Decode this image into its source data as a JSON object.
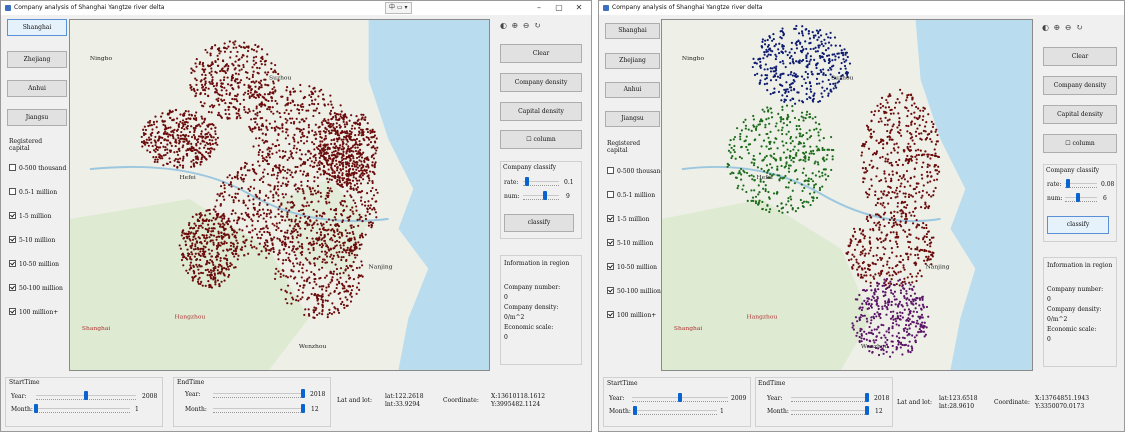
{
  "left": {
    "title": "Company analysis of Shanghai Yangtze river delta",
    "lang_label": "中 ▭ ▾",
    "provinces": [
      "Shanghai",
      "Zhejiang",
      "Anhui",
      "Jiangsu"
    ],
    "capital_heading": "Registered capital",
    "capital_items": [
      {
        "label": "0-500 thousand",
        "checked": false
      },
      {
        "label": "0.5-1 million",
        "checked": false
      },
      {
        "label": "1-5 million",
        "checked": true
      },
      {
        "label": "5-10 million",
        "checked": true
      },
      {
        "label": "10-50 million",
        "checked": true
      },
      {
        "label": "50-100 million",
        "checked": true
      },
      {
        "label": "100 million+",
        "checked": true
      }
    ],
    "tools": "◐ ⊕ ⊖ ↻",
    "clear_label": "Clear",
    "company_density_label": "Company density",
    "capital_density_label": "Capital density",
    "column_label": "column",
    "classify_group": "Company classify",
    "rate_label": "rate:",
    "rate_value": "0.1",
    "rate_level": 0.1,
    "num_label": "num:",
    "num_value": "9",
    "num_level": 0.6,
    "classify_label": "classify",
    "info_heading": "Information in region",
    "company_number_label": "Company number:",
    "company_number": "0",
    "company_density_info_label": "Company density:",
    "company_density_info": "0/m^2",
    "economic_scale_label": "Economic scale:",
    "economic_scale": "0",
    "start_time_label": "StartTime",
    "end_time_label": "EndTime",
    "year_label": "Year:",
    "month_label": "Month:",
    "start_year": "2008",
    "start_month": "1",
    "end_year": "2018",
    "end_month": "12",
    "start_year_level": 0.5,
    "start_month_level": 0.0,
    "end_year_level": 1.0,
    "end_month_level": 1.0,
    "latlot_label": "Lat and lot:",
    "lat": "lat:122.2618",
    "lnt": "lnt:33.9294",
    "coordinate_label": "Coordinate:",
    "coord_x": "X:13610118.1612",
    "coord_y": "Y:3995482.1124",
    "map_labels": [
      "Shanghai",
      "Hefei",
      "Nanjing",
      "Hangzhou",
      "Ningbo",
      "Wenzhou",
      "Suzhou"
    ]
  },
  "right": {
    "title": "Company analysis of Shanghai Yangtze river delta",
    "provinces": [
      "Shanghai",
      "Zhejiang",
      "Anhui",
      "Jiangsu"
    ],
    "capital_heading": "Registered capital",
    "capital_items": [
      {
        "label": "0-500 thousand",
        "checked": false
      },
      {
        "label": "0.5-1 million",
        "checked": false
      },
      {
        "label": "1-5 million",
        "checked": true
      },
      {
        "label": "5-10 million",
        "checked": true
      },
      {
        "label": "10-50 million",
        "checked": true
      },
      {
        "label": "50-100 million",
        "checked": true
      },
      {
        "label": "100 million+",
        "checked": true
      }
    ],
    "tools": "◐ ⊕ ⊖ ↻",
    "clear_label": "Clear",
    "company_density_label": "Company density",
    "capital_density_label": "Capital density",
    "column_label": "column",
    "classify_group": "Company classify",
    "rate_label": "rate:",
    "rate_value": "0.08",
    "rate_level": 0.08,
    "num_label": "num:",
    "num_value": "6",
    "num_level": 0.4,
    "classify_label": "classify",
    "info_heading": "Information in region",
    "company_number_label": "Company number:",
    "company_number": "0",
    "company_density_info_label": "Company density:",
    "company_density_info": "0/m^2",
    "economic_scale_label": "Economic scale:",
    "economic_scale": "0",
    "start_time_label": "StartTime",
    "end_time_label": "EndTime",
    "year_label": "Year:",
    "month_label": "Month:",
    "start_year": "2009",
    "start_month": "1",
    "end_year": "2018",
    "end_month": "12",
    "start_year_level": 0.5,
    "start_month_level": 0.0,
    "end_year_level": 1.0,
    "end_month_level": 1.0,
    "latlot_label": "Lat and lot:",
    "lat": "lat:123.6518",
    "lnt": "lnt:28.9610",
    "coordinate_label": "Coordinate:",
    "coord_x": "X:13764851.1943",
    "coord_y": "Y:3350070.0173",
    "map_labels": [
      "Shanghai",
      "Hefei",
      "Nanjing",
      "Hangzhou",
      "Ningbo",
      "Wenzhou",
      "Suzhou"
    ]
  },
  "colors": {
    "dots_single": "#6b0c0c",
    "cluster_blue": "#0d1a6e",
    "cluster_green": "#1d6b1a",
    "cluster_red": "#6b0c0c",
    "cluster_purple": "#5b1566",
    "sea": "#b9dcef",
    "land": "#eef0e8",
    "accent": "#0a64d0"
  }
}
